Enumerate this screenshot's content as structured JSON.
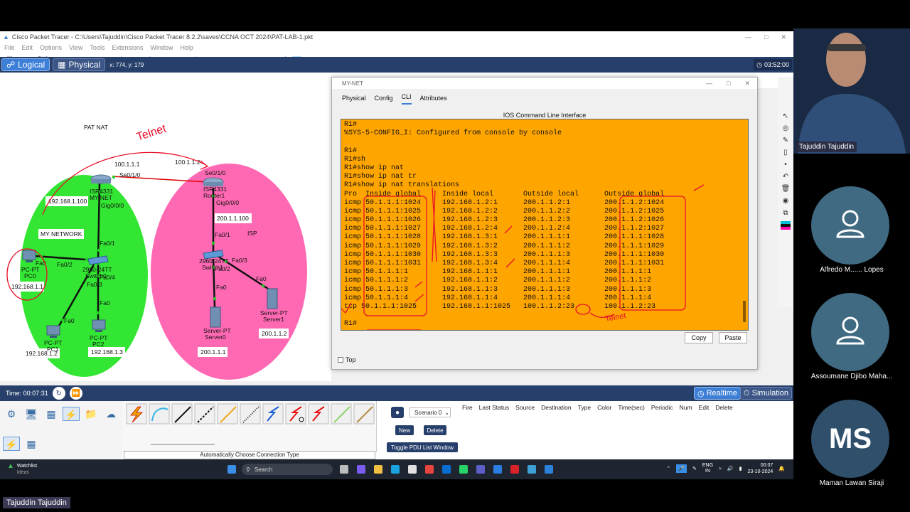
{
  "app": {
    "title": "Cisco Packet Tracer - C:\\Users\\Tajuddin\\Cisco Packet Tracer 8.2.2\\saves\\CCNA OCT 2024\\PAT-LAB-1.pkt",
    "menu": [
      "File",
      "Edit",
      "Options",
      "View",
      "Tools",
      "Extensions",
      "Window",
      "Help"
    ],
    "tabs": {
      "logical": "Logical",
      "physical": "Physical"
    },
    "coords": "x: 774, y: 179",
    "clock": "03:52:00"
  },
  "topology": {
    "title": "PAT NAT",
    "annotation": "Telnet",
    "labels": {
      "ip_100_1_1_1": "100.1.1.1",
      "se010": "Se0/1/0",
      "ip_100_1_1_2": "100.1.1.2",
      "se010_r": "Se0/1/0",
      "isr_left": "ISR4331",
      "mynet": "MY-NET",
      "gig000_left": "Gig0/0/0",
      "ip_192_168_1_100": "192.168.1.100",
      "mynetwork": "MY NETWORK",
      "fa01_left": "Fa0/1",
      "fa02_left": "Fa0/2",
      "sw_left": "2960-24TT",
      "sw_left2": "Switch0",
      "fa04": "Fa0/4",
      "fa03_left": "Fa0/3",
      "fa0_pc0": "Fa0",
      "pc0": "PC-PT",
      "pc0_name": "PC0",
      "pc0_ip": "192.168.1.1",
      "fa0_pc1": "Fa0",
      "pc1": "PC-PT",
      "pc1_name": "PC1",
      "pc1_ip": "192.168.1.2",
      "fa0_pc2": "Fa0",
      "pc2": "PC-PT",
      "pc2_name": "PC2",
      "pc2_ip": "192.168.1.3",
      "isr_right": "ISR4331",
      "router1": "Router1",
      "gig000_right": "Gig0/0/0",
      "ip_200_1_1_100": "200.1.1.100",
      "isp": "ISP",
      "fa01_right": "Fa0/1",
      "sw_right": "2960-24TT",
      "sw_right2": "Switch1",
      "fa03_right": "Fa0/3",
      "fa02_right": "Fa0/2",
      "fa0_srv0": "Fa0",
      "server0": "Server-PT",
      "server0_name": "Server0",
      "server0_ip": "200.1.1.1",
      "fa0_srv1": "Fa0",
      "server1": "Server-PT",
      "server1_name": "Server1",
      "server1_ip": "200.1.1.2"
    }
  },
  "dialog": {
    "title": "MY-NET",
    "tabs": [
      "Physical",
      "Config",
      "CLI",
      "Attributes"
    ],
    "cli_heading": "IOS Command Line Interface",
    "lines": [
      "R1#",
      "%SYS-5-CONFIG_I: Configured from console by console",
      "",
      "R1#",
      "R1#sh",
      "R1#show ip nat",
      "R1#show ip nat tr",
      "R1#show ip nat translations",
      "Pro  Inside global     Inside local       Outside local      Outside global",
      "icmp 50.1.1.1:1024     192.168.1.2:1      200.1.1.2:1        200.1.1.2:1024",
      "icmp 50.1.1.1:1025     192.168.1.2:2      200.1.1.2:2        200.1.1.2:1025",
      "icmp 50.1.1.1:1026     192.168.1.2:3      200.1.1.2:3        200.1.1.2:1026",
      "icmp 50.1.1.1:1027     192.168.1.2:4      200.1.1.2:4        200.1.1.2:1027",
      "icmp 50.1.1.1:1028     192.168.1.3:1      200.1.1.1:1        200.1.1.1:1028",
      "icmp 50.1.1.1:1029     192.168.1.3:2      200.1.1.1:2        200.1.1.1:1029",
      "icmp 50.1.1.1:1030     192.168.1.3:3      200.1.1.1:3        200.1.1.1:1030",
      "icmp 50.1.1.1:1031     192.168.1.3:4      200.1.1.1:4        200.1.1.1:1031",
      "icmp 50.1.1.1:1        192.168.1.1:1      200.1.1.1:1        200.1.1.1:1",
      "icmp 50.1.1.1:2        192.168.1.1:2      200.1.1.1:2        200.1.1.1:2",
      "icmp 50.1.1.1:3        192.168.1.1:3      200.1.1.1:3        200.1.1.1:3",
      "icmp 50.1.1.1:4        192.168.1.1:4      200.1.1.1:4        200.1.1.1:4",
      "tcp 50.1.1.1:1025      192.168.1.1:1025   100.1.1.2:23       100.1.1.2:23",
      "",
      "R1#"
    ],
    "copy": "Copy",
    "paste": "Paste",
    "top_label": "Top"
  },
  "timebar": {
    "time": "Time: 00:07:31",
    "realtime": "Realtime",
    "simulation": "Simulation"
  },
  "bottom": {
    "conn_label": "Automatically Choose Connection Type",
    "scenario": "Scenario 0",
    "new": "New",
    "delete": "Delete",
    "toggle": "Toggle PDU List Window",
    "event_cols": [
      "Fire",
      "Last Status",
      "Source",
      "Destination",
      "Type",
      "Color",
      "Time(sec)",
      "Periodic",
      "Num",
      "Edit",
      "Delete"
    ]
  },
  "participants": {
    "host": "Tajuddin Tajuddin",
    "p1": "Alfredo M...... Lopes",
    "p2": "Assoumane Djibo Maha...",
    "p3_initials": "MS",
    "p3": "Maman Lawan Siraji",
    "speaker": "Tajuddin Tajuddin"
  },
  "taskbar": {
    "watchlist": "Watchlist",
    "watchlist_sub": "Ideas",
    "search": "Search",
    "lang": "ENG",
    "lang2": "IN",
    "time": "00:07",
    "date": "23-10-2024"
  },
  "colors": {
    "cli_bg": "#ffa500",
    "left_cloud": "#33e633",
    "right_cloud": "#ff69b4",
    "ink": "#e8102a",
    "tab_blue": "#27406b"
  }
}
